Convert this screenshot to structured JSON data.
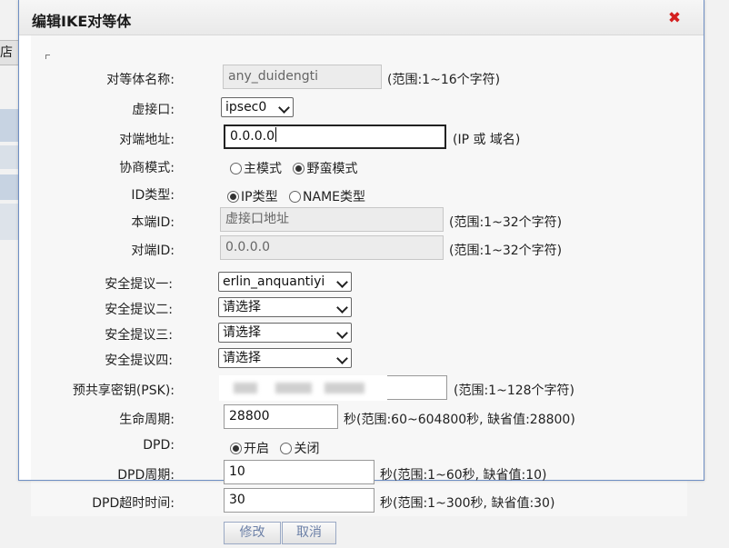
{
  "background": {
    "fragment_text": "店"
  },
  "dialog": {
    "title": "编辑IKE对等体",
    "close_icon": "close-icon"
  },
  "form": {
    "peer_name": {
      "label": "对等体名称:",
      "value": "any_duidengti",
      "hint": "(范围:1~16个字符)"
    },
    "virtual_interface": {
      "label": "虚接口:",
      "selected": "ipsec0"
    },
    "remote_address": {
      "label": "对端地址:",
      "value": "0.0.0.0",
      "hint": "(IP 或 域名)"
    },
    "negotiation_mode": {
      "label": "协商模式:",
      "options": [
        "主模式",
        "野蛮模式"
      ],
      "selected": "野蛮模式"
    },
    "id_type": {
      "label": "ID类型:",
      "options": [
        "IP类型",
        "NAME类型"
      ],
      "selected": "IP类型"
    },
    "local_id": {
      "label": "本端ID:",
      "placeholder": "虚接口地址",
      "hint": "(范围:1~32个字符)"
    },
    "remote_id": {
      "label": "对端ID:",
      "placeholder": "0.0.0.0",
      "hint": "(范围:1~32个字符)"
    },
    "proposal_1": {
      "label": "安全提议一:",
      "selected": "erlin_anquantiyi"
    },
    "proposal_2": {
      "label": "安全提议二:",
      "selected": "请选择"
    },
    "proposal_3": {
      "label": "安全提议三:",
      "selected": "请选择"
    },
    "proposal_4": {
      "label": "安全提议四:",
      "selected": "请选择"
    },
    "psk": {
      "label": "预共享密钥(PSK):",
      "hint": "(范围:1~128个字符)"
    },
    "lifetime": {
      "label": "生命周期:",
      "value": "28800",
      "hint": "秒(范围:60~604800秒, 缺省值:28800)"
    },
    "dpd": {
      "label": "DPD:",
      "options": [
        "开启",
        "关闭"
      ],
      "selected": "开启"
    },
    "dpd_period": {
      "label": "DPD周期:",
      "value": "10",
      "hint": "秒(范围:1~60秒, 缺省值:10)"
    },
    "dpd_timeout": {
      "label": "DPD超时时间:",
      "value": "30",
      "hint": "秒(范围:1~300秒, 缺省值:30)"
    }
  },
  "buttons": {
    "modify": "修改",
    "cancel": "取消"
  },
  "colors": {
    "dialog_border": "#6f8fc4",
    "close_icon": "#d42020",
    "button_text": "#6b7fa6"
  }
}
